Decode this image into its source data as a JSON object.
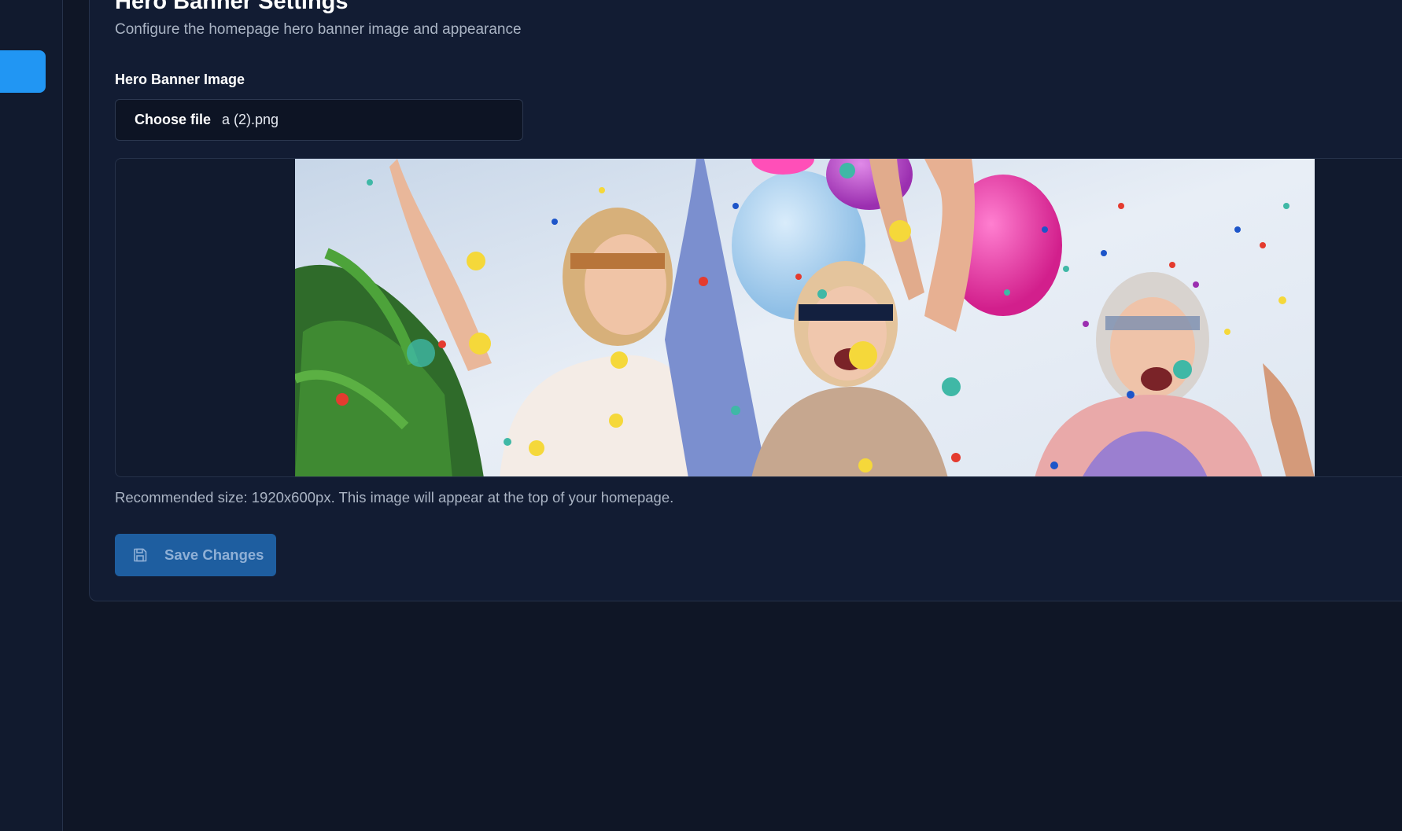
{
  "page": {
    "title": "Hero Banner Settings",
    "subtitle": "Configure the homepage hero banner image and appearance"
  },
  "hero_banner": {
    "label": "Hero Banner Image",
    "choose_file_label": "Choose file",
    "file_name": "a (2).png",
    "preview_alt": "Hero banner preview",
    "hint": "Recommended size: 1920x600px. This image will appear at the top of your homepage."
  },
  "actions": {
    "save_label": "Save Changes",
    "save_icon": "save-icon"
  },
  "colors": {
    "background": "#0f1626",
    "card": "#121c33",
    "accent": "#2196f3",
    "save_button": "#1e5ea0"
  }
}
